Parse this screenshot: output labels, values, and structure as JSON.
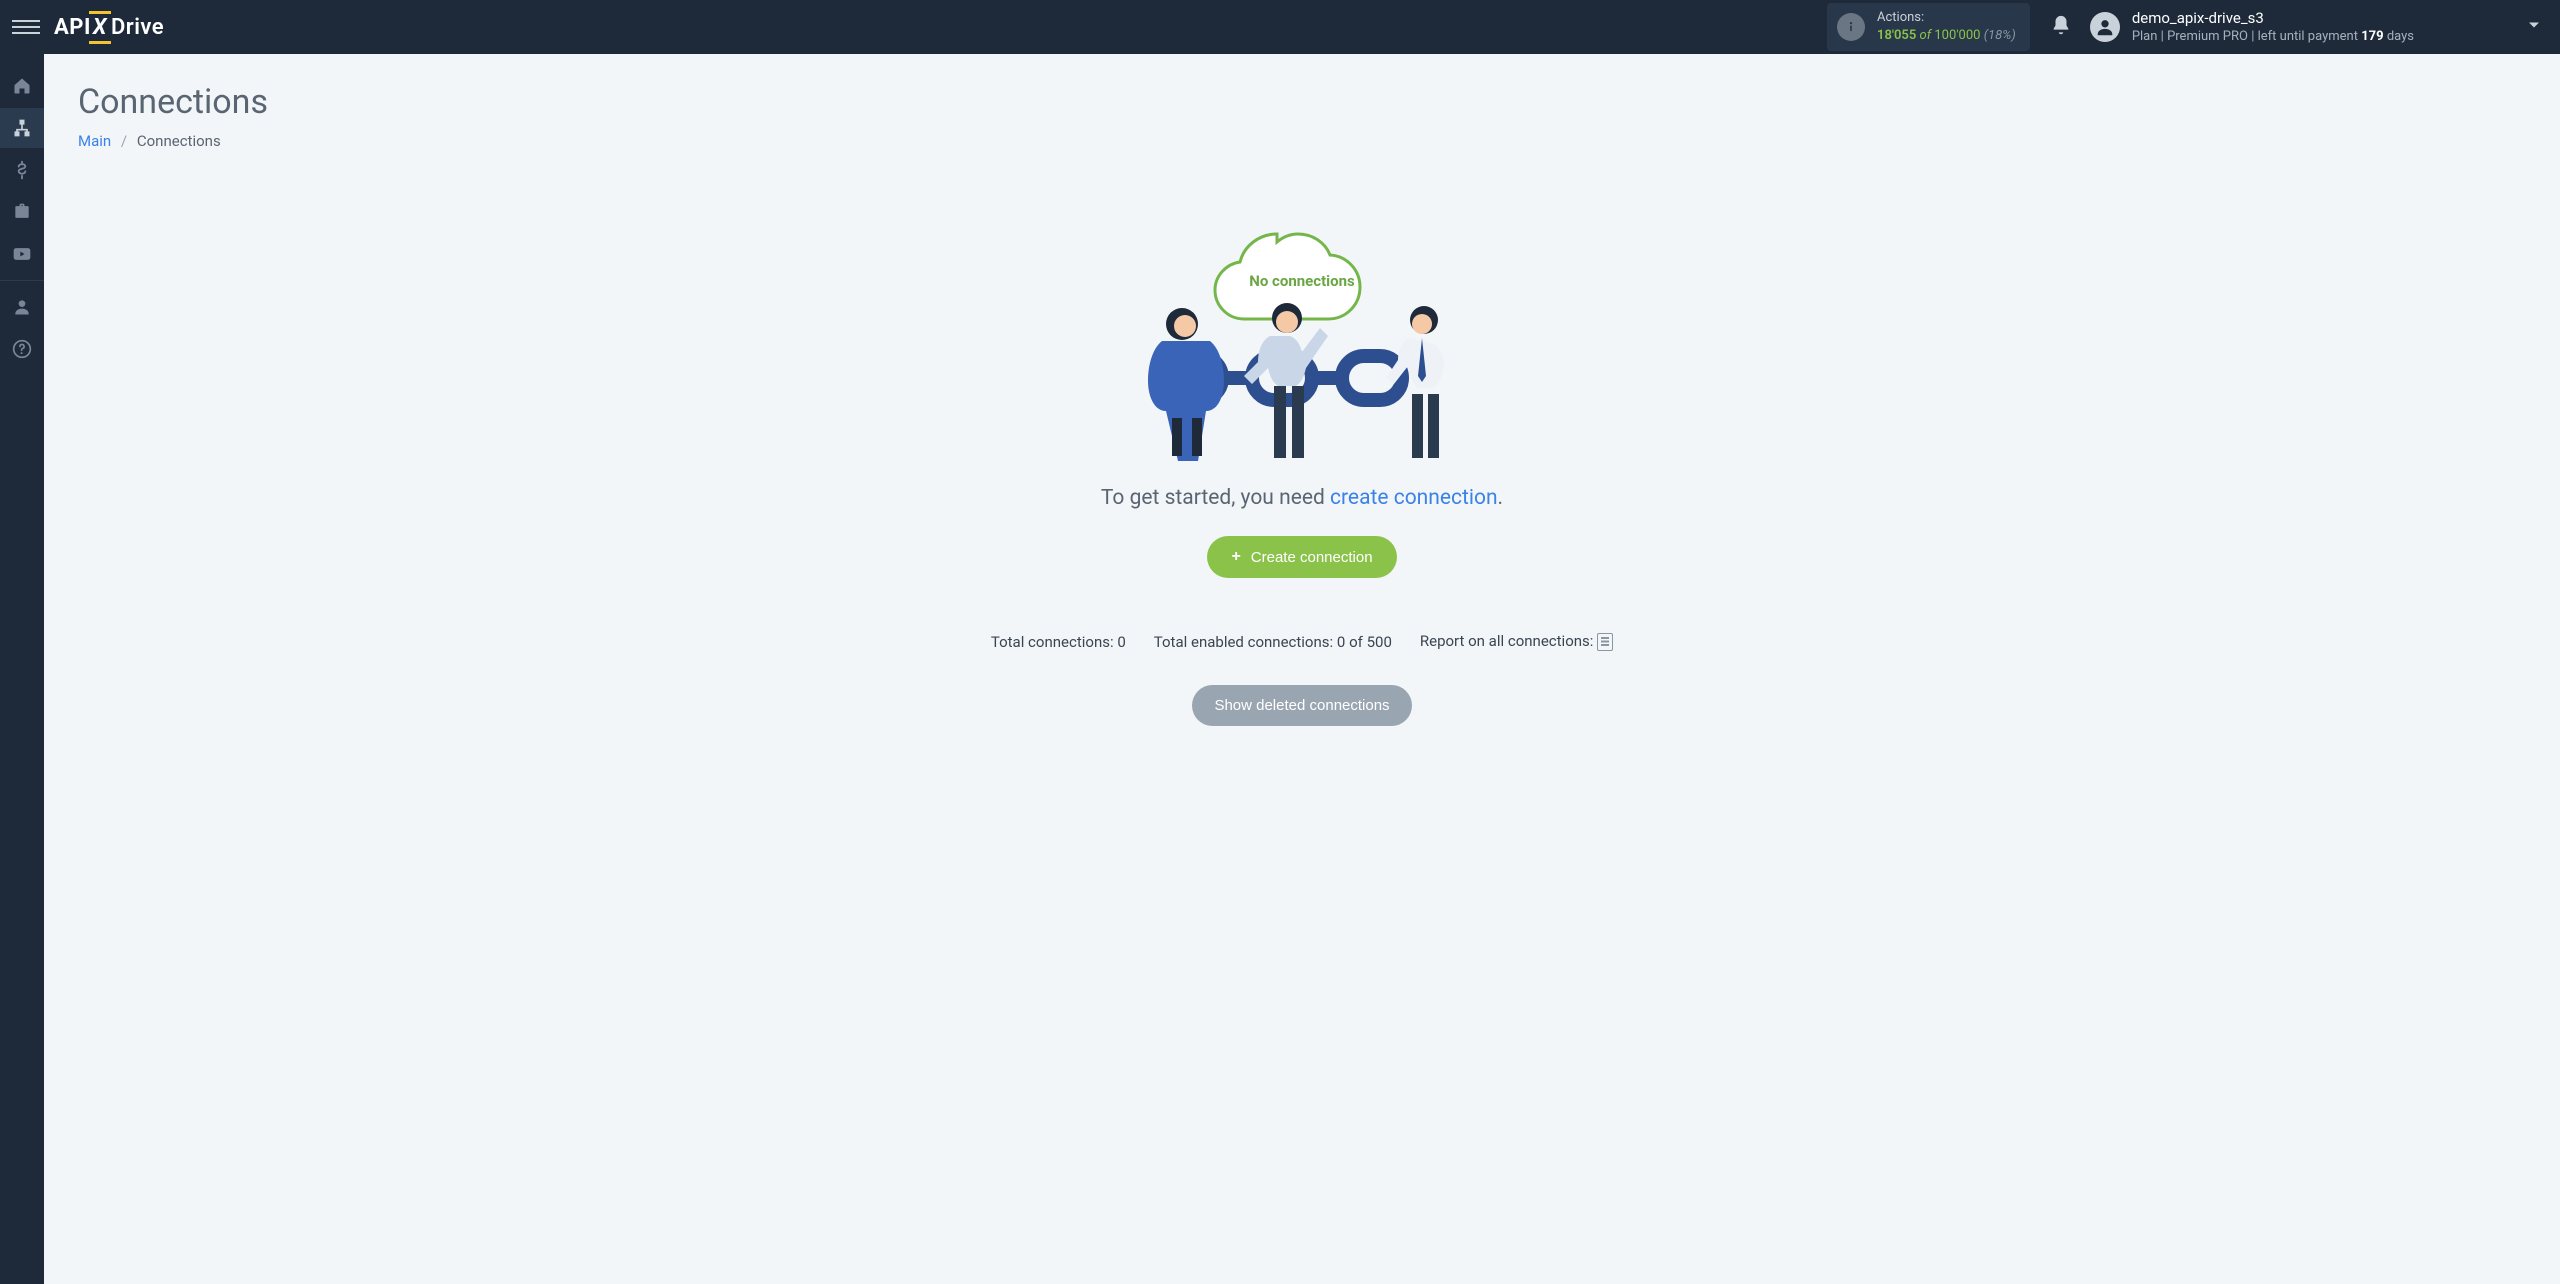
{
  "header": {
    "logo": {
      "part1": "API",
      "part2": "X",
      "part3": "Drive"
    },
    "actions": {
      "label": "Actions:",
      "used": "18'055",
      "of": "of",
      "limit": "100'000",
      "percent": "(18%)"
    },
    "user": {
      "name": "demo_apix-drive_s3",
      "plan_prefix": "Plan |",
      "plan_name": "Premium PRO",
      "plan_sep": "|",
      "payment_prefix": "left until payment",
      "days": "179",
      "days_suffix": "days"
    }
  },
  "sidebar": {
    "items": [
      {
        "name": "home"
      },
      {
        "name": "connections"
      },
      {
        "name": "billing"
      },
      {
        "name": "tools"
      },
      {
        "name": "video"
      },
      {
        "name": "account"
      },
      {
        "name": "help"
      }
    ]
  },
  "page": {
    "title": "Connections",
    "breadcrumb": {
      "root": "Main",
      "current": "Connections",
      "sep": "/"
    }
  },
  "empty": {
    "cloud_label": "No connections",
    "start_prefix": "To get started, you need ",
    "start_link": "create connection",
    "start_suffix": ".",
    "create_button": "Create connection"
  },
  "stats": {
    "total_label": "Total connections:",
    "total_value": "0",
    "enabled_label": "Total enabled connections:",
    "enabled_value": "0",
    "enabled_of": "of",
    "enabled_limit": "500",
    "report_label": "Report on all connections:"
  },
  "buttons": {
    "show_deleted": "Show deleted connections"
  }
}
